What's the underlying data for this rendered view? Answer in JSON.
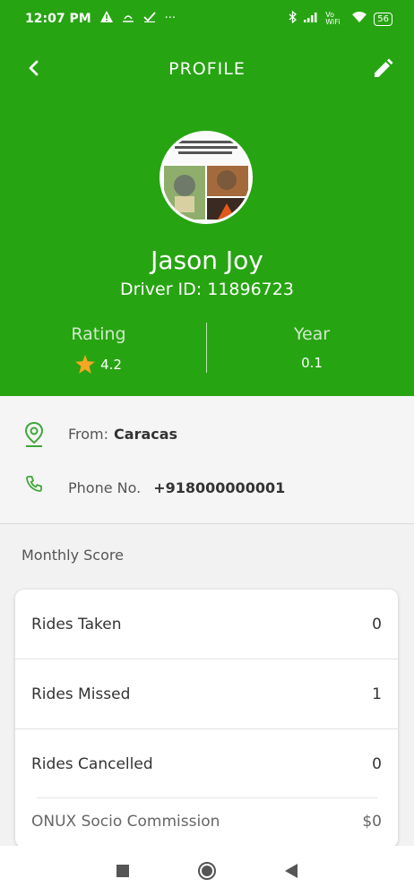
{
  "status_bar": {
    "time": "12:07 PM",
    "overflow_dots": "···",
    "network_label": "Vo WiFi",
    "battery": "56"
  },
  "header": {
    "title": "PROFILE"
  },
  "profile": {
    "name": "Jason Joy",
    "driver_id": "Driver ID: 11896723",
    "rating_label": "Rating",
    "rating_value": "4.2",
    "year_label": "Year",
    "year_value": "0.1"
  },
  "info": {
    "from_label": "From:",
    "from_value": "Caracas",
    "phone_label": "Phone No.",
    "phone_value": "+918000000001"
  },
  "monthly": {
    "title": "Monthly Score",
    "rows": [
      {
        "label": "Rides Taken",
        "value": "0"
      },
      {
        "label": "Rides Missed",
        "value": "1"
      },
      {
        "label": "Rides Cancelled",
        "value": "0"
      },
      {
        "label": "ONUX Socio Commission",
        "value": "$0"
      }
    ]
  },
  "colors": {
    "brand_green": "#27a412",
    "star": "#f5a623"
  },
  "icons": {
    "back": "arrow-back-icon",
    "edit": "pencil-icon",
    "location": "location-pin-icon",
    "phone": "phone-icon",
    "star": "star-icon"
  }
}
